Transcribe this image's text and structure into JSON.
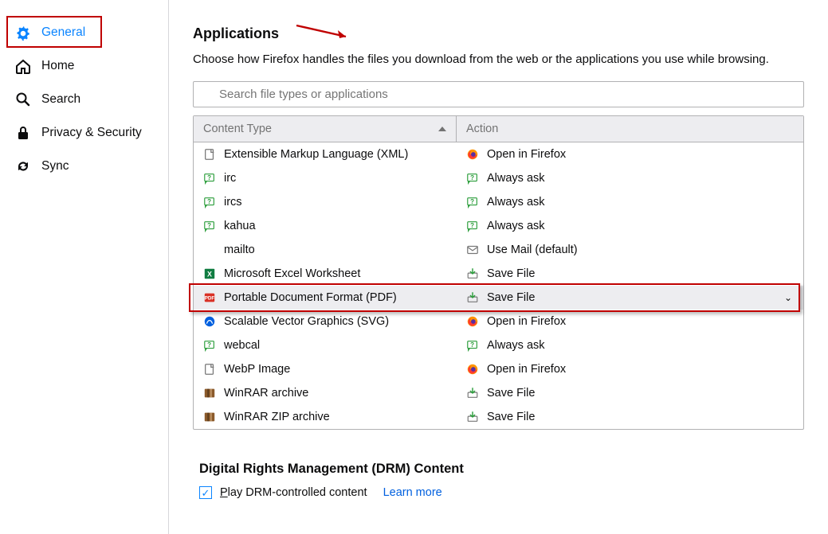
{
  "sidebar": {
    "items": [
      {
        "label": "General"
      },
      {
        "label": "Home"
      },
      {
        "label": "Search"
      },
      {
        "label": "Privacy & Security"
      },
      {
        "label": "Sync"
      }
    ]
  },
  "applications": {
    "title": "Applications",
    "desc": "Choose how Firefox handles the files you download from the web or the applications you use while browsing.",
    "search_placeholder": "Search file types or applications",
    "col_content": "Content Type",
    "col_action": "Action",
    "rows": [
      {
        "ct": "Extensible Markup Language (XML)",
        "ac": "Open in Firefox",
        "ct_icon": "file",
        "ac_icon": "firefox"
      },
      {
        "ct": "irc",
        "ac": "Always ask",
        "ct_icon": "ask",
        "ac_icon": "ask"
      },
      {
        "ct": "ircs",
        "ac": "Always ask",
        "ct_icon": "ask",
        "ac_icon": "ask"
      },
      {
        "ct": "kahua",
        "ac": "Always ask",
        "ct_icon": "ask",
        "ac_icon": "ask"
      },
      {
        "ct": "mailto",
        "ac": "Use Mail (default)",
        "ct_icon": "blank",
        "ac_icon": "mail"
      },
      {
        "ct": "Microsoft Excel Worksheet",
        "ac": "Save File",
        "ct_icon": "excel",
        "ac_icon": "save"
      },
      {
        "ct": "Portable Document Format (PDF)",
        "ac": "Save File",
        "ct_icon": "pdf",
        "ac_icon": "save",
        "selected": true
      },
      {
        "ct": "Scalable Vector Graphics (SVG)",
        "ac": "Open in Firefox",
        "ct_icon": "svg",
        "ac_icon": "firefox"
      },
      {
        "ct": "webcal",
        "ac": "Always ask",
        "ct_icon": "ask",
        "ac_icon": "ask"
      },
      {
        "ct": "WebP Image",
        "ac": "Open in Firefox",
        "ct_icon": "file",
        "ac_icon": "firefox"
      },
      {
        "ct": "WinRAR archive",
        "ac": "Save File",
        "ct_icon": "rar",
        "ac_icon": "save"
      },
      {
        "ct": "WinRAR ZIP archive",
        "ac": "Save File",
        "ct_icon": "rar",
        "ac_icon": "save"
      }
    ]
  },
  "drm": {
    "title": "Digital Rights Management (DRM) Content",
    "checkbox_label_pre": "P",
    "checkbox_label_post": "lay DRM-controlled content",
    "learn": "Learn more"
  }
}
